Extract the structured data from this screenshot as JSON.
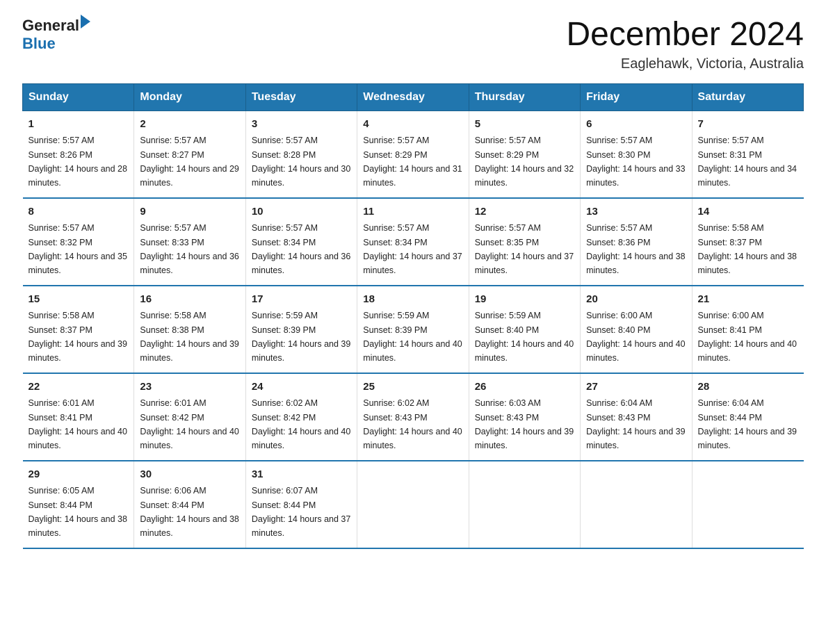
{
  "header": {
    "logo_general": "General",
    "logo_blue": "Blue",
    "main_title": "December 2024",
    "subtitle": "Eaglehawk, Victoria, Australia"
  },
  "days_of_week": [
    "Sunday",
    "Monday",
    "Tuesday",
    "Wednesday",
    "Thursday",
    "Friday",
    "Saturday"
  ],
  "weeks": [
    [
      {
        "num": "1",
        "sunrise": "5:57 AM",
        "sunset": "8:26 PM",
        "daylight": "14 hours and 28 minutes."
      },
      {
        "num": "2",
        "sunrise": "5:57 AM",
        "sunset": "8:27 PM",
        "daylight": "14 hours and 29 minutes."
      },
      {
        "num": "3",
        "sunrise": "5:57 AM",
        "sunset": "8:28 PM",
        "daylight": "14 hours and 30 minutes."
      },
      {
        "num": "4",
        "sunrise": "5:57 AM",
        "sunset": "8:29 PM",
        "daylight": "14 hours and 31 minutes."
      },
      {
        "num": "5",
        "sunrise": "5:57 AM",
        "sunset": "8:29 PM",
        "daylight": "14 hours and 32 minutes."
      },
      {
        "num": "6",
        "sunrise": "5:57 AM",
        "sunset": "8:30 PM",
        "daylight": "14 hours and 33 minutes."
      },
      {
        "num": "7",
        "sunrise": "5:57 AM",
        "sunset": "8:31 PM",
        "daylight": "14 hours and 34 minutes."
      }
    ],
    [
      {
        "num": "8",
        "sunrise": "5:57 AM",
        "sunset": "8:32 PM",
        "daylight": "14 hours and 35 minutes."
      },
      {
        "num": "9",
        "sunrise": "5:57 AM",
        "sunset": "8:33 PM",
        "daylight": "14 hours and 36 minutes."
      },
      {
        "num": "10",
        "sunrise": "5:57 AM",
        "sunset": "8:34 PM",
        "daylight": "14 hours and 36 minutes."
      },
      {
        "num": "11",
        "sunrise": "5:57 AM",
        "sunset": "8:34 PM",
        "daylight": "14 hours and 37 minutes."
      },
      {
        "num": "12",
        "sunrise": "5:57 AM",
        "sunset": "8:35 PM",
        "daylight": "14 hours and 37 minutes."
      },
      {
        "num": "13",
        "sunrise": "5:57 AM",
        "sunset": "8:36 PM",
        "daylight": "14 hours and 38 minutes."
      },
      {
        "num": "14",
        "sunrise": "5:58 AM",
        "sunset": "8:37 PM",
        "daylight": "14 hours and 38 minutes."
      }
    ],
    [
      {
        "num": "15",
        "sunrise": "5:58 AM",
        "sunset": "8:37 PM",
        "daylight": "14 hours and 39 minutes."
      },
      {
        "num": "16",
        "sunrise": "5:58 AM",
        "sunset": "8:38 PM",
        "daylight": "14 hours and 39 minutes."
      },
      {
        "num": "17",
        "sunrise": "5:59 AM",
        "sunset": "8:39 PM",
        "daylight": "14 hours and 39 minutes."
      },
      {
        "num": "18",
        "sunrise": "5:59 AM",
        "sunset": "8:39 PM",
        "daylight": "14 hours and 40 minutes."
      },
      {
        "num": "19",
        "sunrise": "5:59 AM",
        "sunset": "8:40 PM",
        "daylight": "14 hours and 40 minutes."
      },
      {
        "num": "20",
        "sunrise": "6:00 AM",
        "sunset": "8:40 PM",
        "daylight": "14 hours and 40 minutes."
      },
      {
        "num": "21",
        "sunrise": "6:00 AM",
        "sunset": "8:41 PM",
        "daylight": "14 hours and 40 minutes."
      }
    ],
    [
      {
        "num": "22",
        "sunrise": "6:01 AM",
        "sunset": "8:41 PM",
        "daylight": "14 hours and 40 minutes."
      },
      {
        "num": "23",
        "sunrise": "6:01 AM",
        "sunset": "8:42 PM",
        "daylight": "14 hours and 40 minutes."
      },
      {
        "num": "24",
        "sunrise": "6:02 AM",
        "sunset": "8:42 PM",
        "daylight": "14 hours and 40 minutes."
      },
      {
        "num": "25",
        "sunrise": "6:02 AM",
        "sunset": "8:43 PM",
        "daylight": "14 hours and 40 minutes."
      },
      {
        "num": "26",
        "sunrise": "6:03 AM",
        "sunset": "8:43 PM",
        "daylight": "14 hours and 39 minutes."
      },
      {
        "num": "27",
        "sunrise": "6:04 AM",
        "sunset": "8:43 PM",
        "daylight": "14 hours and 39 minutes."
      },
      {
        "num": "28",
        "sunrise": "6:04 AM",
        "sunset": "8:44 PM",
        "daylight": "14 hours and 39 minutes."
      }
    ],
    [
      {
        "num": "29",
        "sunrise": "6:05 AM",
        "sunset": "8:44 PM",
        "daylight": "14 hours and 38 minutes."
      },
      {
        "num": "30",
        "sunrise": "6:06 AM",
        "sunset": "8:44 PM",
        "daylight": "14 hours and 38 minutes."
      },
      {
        "num": "31",
        "sunrise": "6:07 AM",
        "sunset": "8:44 PM",
        "daylight": "14 hours and 37 minutes."
      },
      null,
      null,
      null,
      null
    ]
  ],
  "labels": {
    "sunrise": "Sunrise:",
    "sunset": "Sunset:",
    "daylight": "Daylight:"
  }
}
